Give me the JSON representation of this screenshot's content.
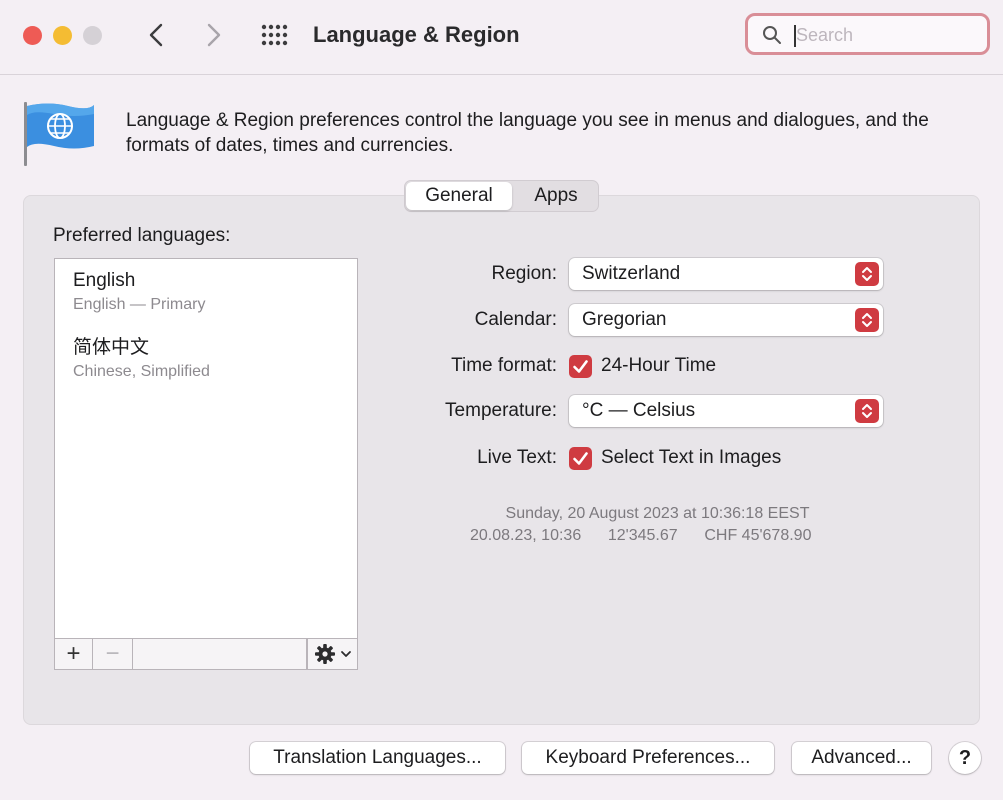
{
  "window": {
    "title": "Language & Region",
    "traffic_lights": {
      "close": "#ee5b55",
      "minimize": "#f4bc33",
      "zoom": "#d5d1d6"
    }
  },
  "search": {
    "placeholder": "Search",
    "value": ""
  },
  "description": "Language & Region preferences control the language you see in menus and dialogues, and the formats of dates, times and currencies.",
  "tabs": [
    {
      "label": "General",
      "selected": true
    },
    {
      "label": "Apps",
      "selected": false
    }
  ],
  "preferred_languages": {
    "label": "Preferred languages:",
    "items": [
      {
        "name": "English",
        "detail": "English — Primary"
      },
      {
        "name": "简体中文",
        "detail": "Chinese, Simplified"
      }
    ],
    "toolbar": {
      "add": "+",
      "remove": "−"
    }
  },
  "settings": {
    "region": {
      "label": "Region:",
      "value": "Switzerland"
    },
    "calendar": {
      "label": "Calendar:",
      "value": "Gregorian"
    },
    "time_format": {
      "label": "Time format:",
      "option": "24-Hour Time",
      "checked": true
    },
    "temperature": {
      "label": "Temperature:",
      "value": "°C — Celsius"
    },
    "live_text": {
      "label": "Live Text:",
      "option": "Select Text in Images",
      "checked": true
    }
  },
  "sample": {
    "date_line": "Sunday, 20 August 2023 at 10:36:18 EEST",
    "formats": "20.08.23, 10:36      12'345.67      CHF 45'678.90"
  },
  "buttons": {
    "translation": "Translation Languages...",
    "keyboard": "Keyboard Preferences...",
    "advanced": "Advanced...",
    "help": "?"
  },
  "colors": {
    "accent": "#cf3b41",
    "search_focus": "#d98e97"
  }
}
